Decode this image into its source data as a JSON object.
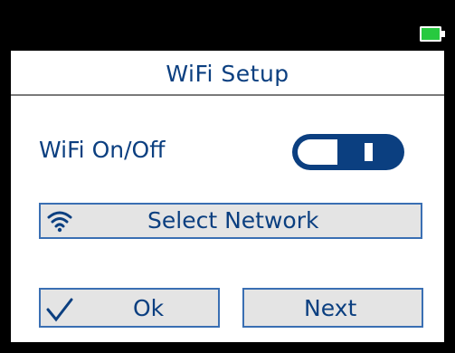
{
  "header": {
    "title": "WiFi Setup",
    "battery_icon": "battery-full-icon"
  },
  "wifi": {
    "label": "WiFi On/Off",
    "toggle_state": "on"
  },
  "network": {
    "button_label": "Select Network",
    "icon": "wifi-icon"
  },
  "actions": {
    "ok_label": "Ok",
    "ok_icon": "checkmark-icon",
    "next_label": "Next"
  },
  "colors": {
    "accent": "#0b3f80",
    "button_bg": "#e4e4e4",
    "button_border": "#3a6fb3",
    "battery": "#2ecc40"
  }
}
